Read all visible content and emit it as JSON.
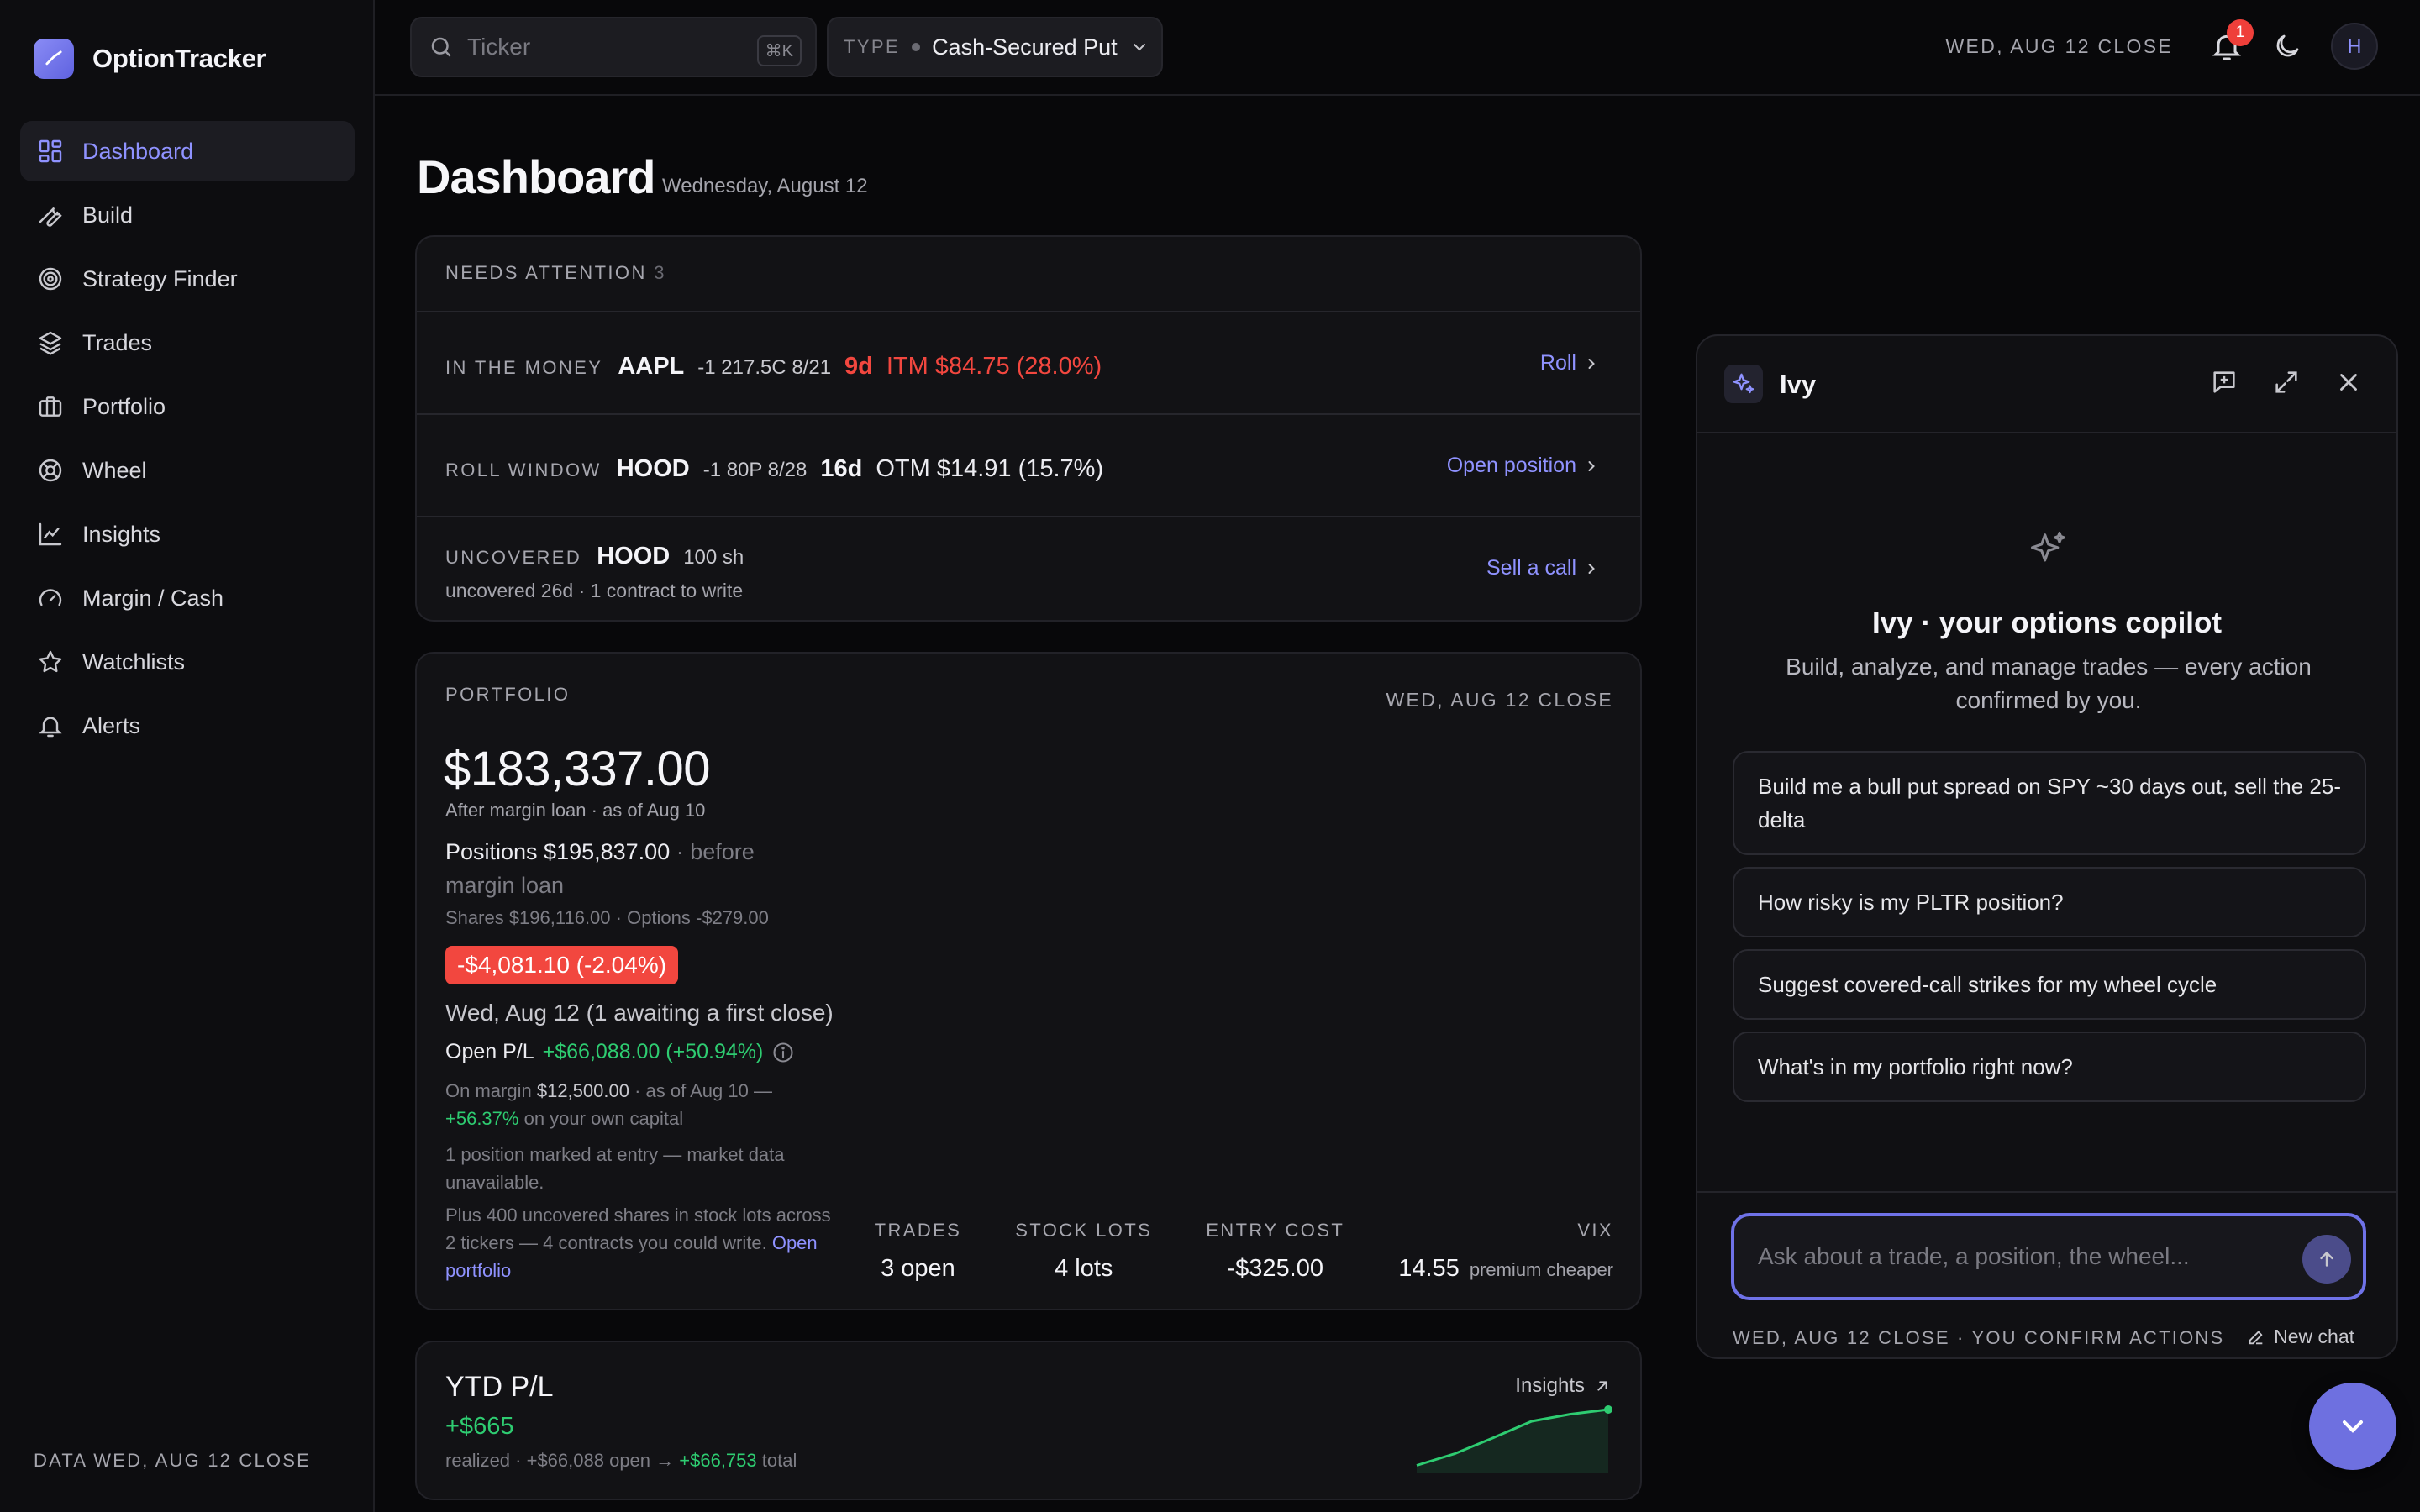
{
  "app": {
    "name": "OptionTracker"
  },
  "sidebar": {
    "items": [
      {
        "label": "Dashboard",
        "icon": "dashboard-icon",
        "active": true
      },
      {
        "label": "Build",
        "icon": "wrench-icon"
      },
      {
        "label": "Strategy Finder",
        "icon": "target-icon"
      },
      {
        "label": "Trades",
        "icon": "layers-icon"
      },
      {
        "label": "Portfolio",
        "icon": "briefcase-icon"
      },
      {
        "label": "Wheel",
        "icon": "wheel-icon"
      },
      {
        "label": "Insights",
        "icon": "chart-line-icon"
      },
      {
        "label": "Margin / Cash",
        "icon": "gauge-icon"
      },
      {
        "label": "Watchlists",
        "icon": "star-icon"
      },
      {
        "label": "Alerts",
        "icon": "bell-icon"
      }
    ],
    "footer": "DATA WED, AUG 12 CLOSE"
  },
  "topbar": {
    "search_placeholder": "Ticker",
    "search_shortcut": "⌘K",
    "type_label": "TYPE",
    "type_value": "Cash-Secured Put",
    "close_label": "WED, AUG 12 CLOSE",
    "notifications_count": "1",
    "avatar_initial": "H"
  },
  "page": {
    "title": "Dashboard",
    "date": "Wednesday, August 12"
  },
  "attention": {
    "label": "NEEDS ATTENTION",
    "count": "3",
    "rows": [
      {
        "kind": "IN THE MONEY",
        "ticker": "AAPL",
        "detail": "-1 217.5C 8/21",
        "days": "9d",
        "money": "ITM $84.75 (28.0%)",
        "action": "Roll"
      },
      {
        "kind": "ROLL WINDOW",
        "ticker": "HOOD",
        "detail": "-1 80P 8/28",
        "days": "16d",
        "money": "OTM $14.91 (15.7%)",
        "action": "Open position"
      },
      {
        "kind": "UNCOVERED",
        "ticker": "HOOD",
        "detail": "100 sh",
        "sub": "uncovered 26d · 1 contract to write",
        "action": "Sell a call"
      }
    ]
  },
  "portfolio": {
    "label": "PORTFOLIO",
    "close_label": "WED, AUG 12 CLOSE",
    "total": "$183,337.00",
    "total_sub": "After margin loan · as of Aug 10",
    "positions_label": "Positions $195,837.00",
    "positions_note": "· before margin loan",
    "breakdown": "Shares $196,116.00 · Options -$279.00",
    "change": "-$4,081.10 (-2.04%)",
    "change_date": "Wed, Aug 12 (1 awaiting a first close)",
    "open_pl_label": "Open P/L",
    "open_pl_value": "+$66,088.00 (+50.94%)",
    "margin_prefix": "On margin",
    "margin_value": "$12,500.00",
    "margin_suffix": "· as of Aug 10 —",
    "margin_return": "+56.37%",
    "margin_return_suffix": "on your own capital",
    "marked_note": "1 position marked at entry — market data unavailable.",
    "uncovered_note": "Plus 400 uncovered shares in stock lots across 2 tickers — 4 contracts you could write.",
    "open_portfolio_link": "Open portfolio",
    "stats": [
      {
        "label": "TRADES",
        "value": "3 open"
      },
      {
        "label": "STOCK LOTS",
        "value": "4 lots"
      },
      {
        "label": "ENTRY COST",
        "value": "-$325.00"
      },
      {
        "label": "VIX",
        "value": "14.55",
        "note": "premium cheaper"
      }
    ]
  },
  "ytd": {
    "title": "YTD P/L",
    "value": "+$665",
    "sub_prefix": "realized · +$66,088 open →",
    "sub_total": "+$66,753",
    "sub_suffix": "total",
    "link": "Insights",
    "spark": [
      0.05,
      0.25,
      0.52,
      0.8,
      0.92,
      1.0
    ]
  },
  "ivy": {
    "name": "Ivy",
    "title": "Ivy · your options copilot",
    "description": "Build, analyze, and manage trades — every action confirmed by you.",
    "suggestions": [
      "Build me a bull put spread on SPY ~30 days out, sell the 25-delta",
      "How risky is my PLTR position?",
      "Suggest covered-call strikes for my wheel cycle",
      "What's in my portfolio right now?"
    ],
    "input_placeholder": "Ask about a trade, a position, the wheel...",
    "footer": "WED, AUG 12 CLOSE · YOU CONFIRM ACTIONS",
    "new_chat": "New chat"
  },
  "colors": {
    "accent": "#8f92ff",
    "negative": "#f2473f",
    "positive": "#2ecc71",
    "background": "#08080a"
  }
}
